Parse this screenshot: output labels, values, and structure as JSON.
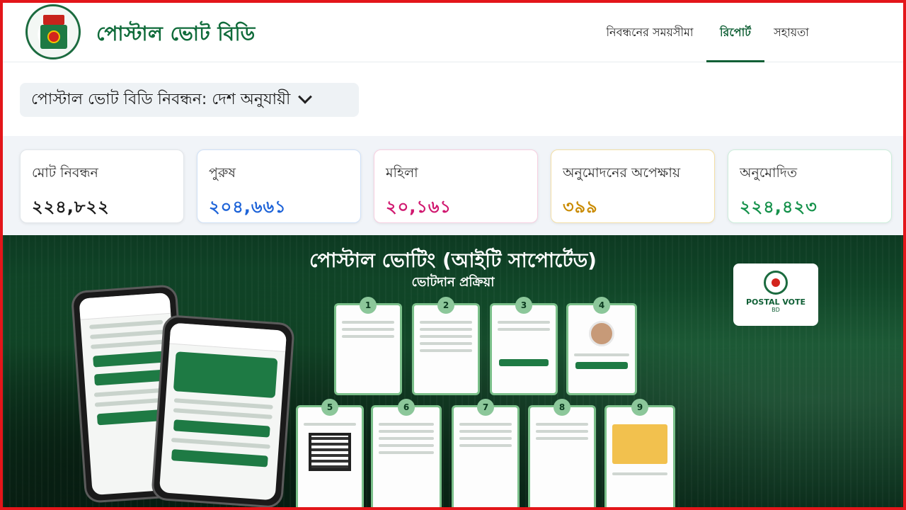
{
  "header": {
    "brand": "পোস্টাল ভোট বিডি",
    "nav": {
      "deadline": "নিবন্ধনের সময়সীমা",
      "report": "রিপোর্ট",
      "help": "সহায়তা"
    }
  },
  "selector": {
    "label": "পোস্টাল ভোট বিডি নিবন্ধন: দেশ অনুযায়ী"
  },
  "stats": [
    {
      "label": "মোট নিবন্ধন",
      "value": "২২৪,৮২২",
      "color": "#1a1a1a",
      "border": "#e2e6ea"
    },
    {
      "label": "পুরুষ",
      "value": "২০৪,৬৬১",
      "color": "#1d63d8",
      "border": "#cfe0f7"
    },
    {
      "label": "মহিলা",
      "value": "২০,১৬১",
      "color": "#d0176f",
      "border": "#f6cfe0"
    },
    {
      "label": "অনুমোদনের অপেক্ষায়",
      "value": "৩৯৯",
      "color": "#c98a00",
      "border": "#f3dfa6"
    },
    {
      "label": "অনুমোদিত",
      "value": "২২৪,৪২৩",
      "color": "#14914a",
      "border": "#cdeedb"
    }
  ],
  "banner": {
    "title": "পোস্টাল ভোটিং (আইটি সাপোর্টেড)",
    "subtitle": "ভোটদান প্রক্রিয়া",
    "badge_line1": "POSTAL VOTE",
    "badge_line2": "BD",
    "steps": [
      "1",
      "2",
      "3",
      "4",
      "5",
      "6",
      "7",
      "8",
      "9"
    ]
  }
}
